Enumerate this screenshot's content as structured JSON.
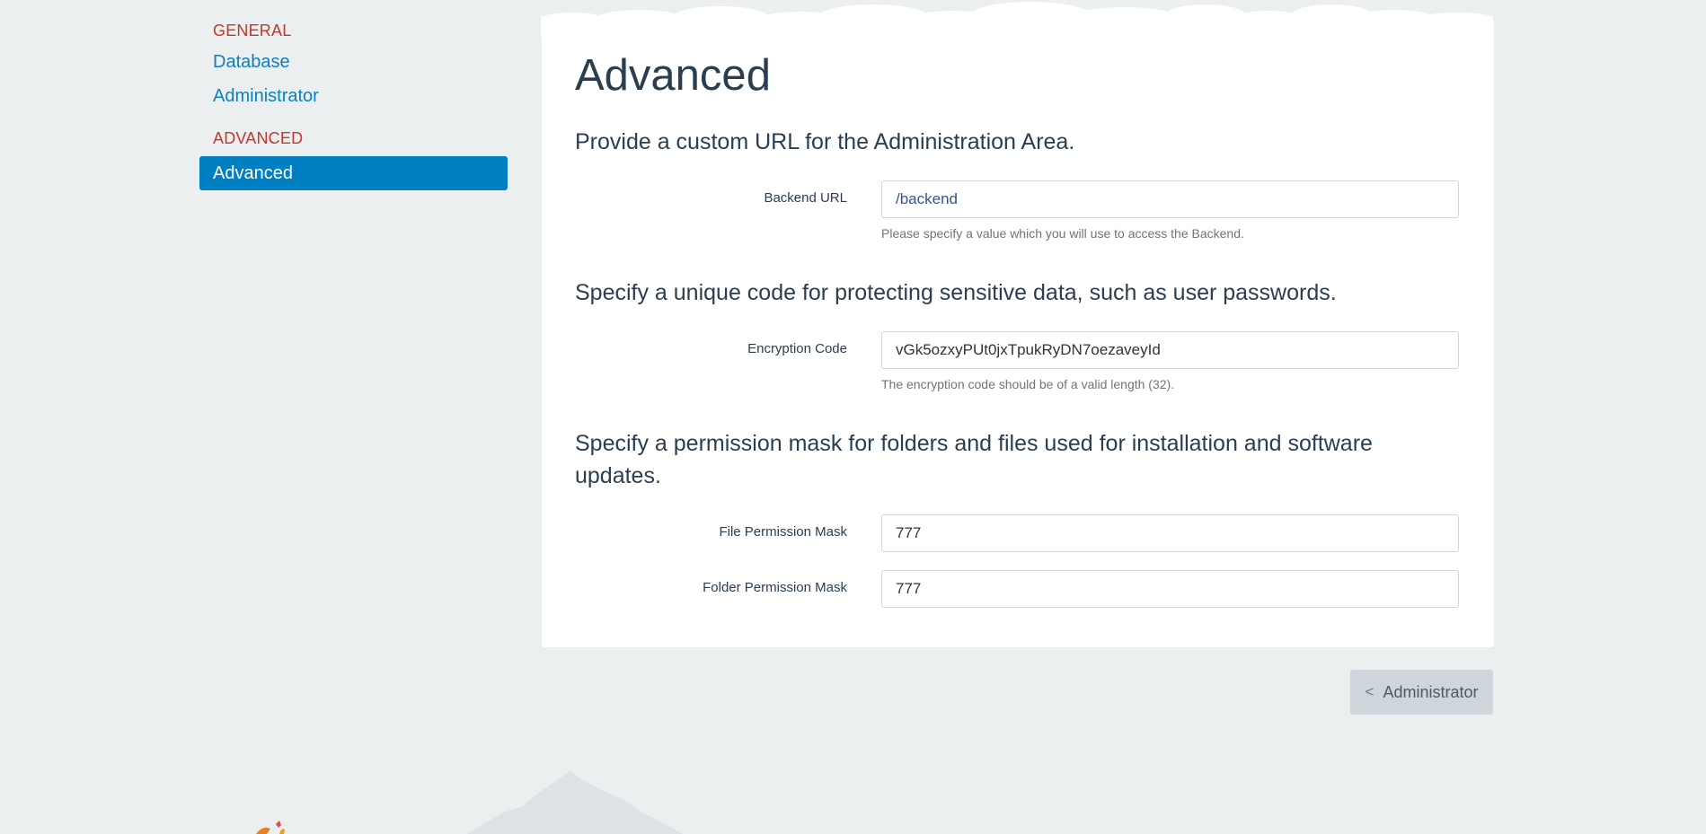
{
  "sidebar": {
    "sections": [
      {
        "heading": "GENERAL",
        "items": [
          "Database",
          "Administrator"
        ]
      },
      {
        "heading": "ADVANCED",
        "items": [
          "Advanced"
        ]
      }
    ]
  },
  "main": {
    "title": "Advanced",
    "sections": [
      {
        "heading": "Provide a custom URL for the Administration Area.",
        "fields": [
          {
            "label": "Backend URL",
            "value": "/backend",
            "help": "Please specify a value which you will use to access the Backend."
          }
        ]
      },
      {
        "heading": "Specify a unique code for protecting sensitive data, such as user passwords.",
        "fields": [
          {
            "label": "Encryption Code",
            "value": "vGk5ozxyPUt0jxTpukRyDN7oezaveyId",
            "help": "The encryption code should be of a valid length (32)."
          }
        ]
      },
      {
        "heading": "Specify a permission mask for folders and files used for installation and software updates.",
        "fields": [
          {
            "label": "File Permission Mask",
            "value": "777"
          },
          {
            "label": "Folder Permission Mask",
            "value": "777"
          }
        ]
      }
    ]
  },
  "footer": {
    "back_label": "Administrator",
    "back_icon": "chevron-left-icon",
    "back_glyph": "<"
  },
  "colors": {
    "background": "#eceff0",
    "panel": "#ffffff",
    "accent": "#0080c2",
    "heading_red": "#c0392b",
    "text": "#2b3e50"
  }
}
